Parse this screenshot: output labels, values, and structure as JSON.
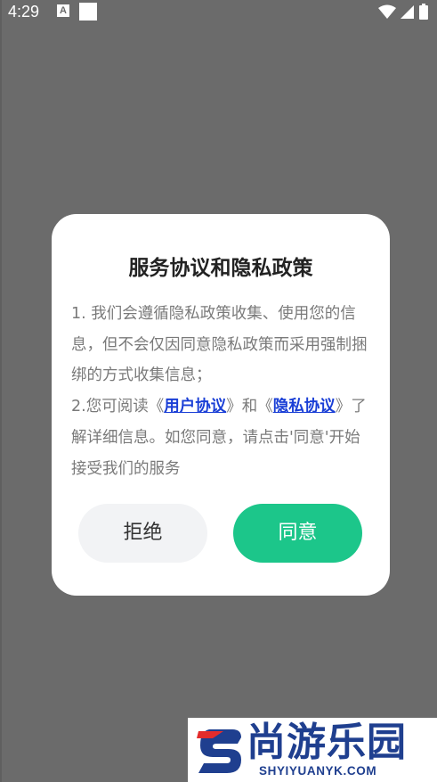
{
  "status_bar": {
    "time": "4:29",
    "notification_icon_letter": "A",
    "icons": [
      "wifi-icon",
      "signal-icon",
      "battery-icon"
    ]
  },
  "dialog": {
    "title": "服务协议和隐私政策",
    "para1": "1. 我们会遵循隐私政策收集、使用您的信息，但不会仅因同意隐私政策而采用强制捆绑的方式收集信息；",
    "para2_prefix": "2.您可阅读《",
    "link_user_agreement": "用户协议",
    "para2_mid": "》和《",
    "link_privacy": "隐私协议",
    "para2_suffix": "》了解详细信息。如您同意，请点击'同意'开始接受我们的服务",
    "reject_label": "拒绝",
    "agree_label": "同意"
  },
  "watermark": {
    "name": "尚游乐园",
    "domain": "SHYIYUANYK.COM"
  },
  "colors": {
    "overlay": "#6b6b6b",
    "accent_green": "#1cc68a",
    "link_blue": "#1a3fd6",
    "watermark_blue": "#1f3f8f",
    "watermark_red": "#e32c2c"
  }
}
